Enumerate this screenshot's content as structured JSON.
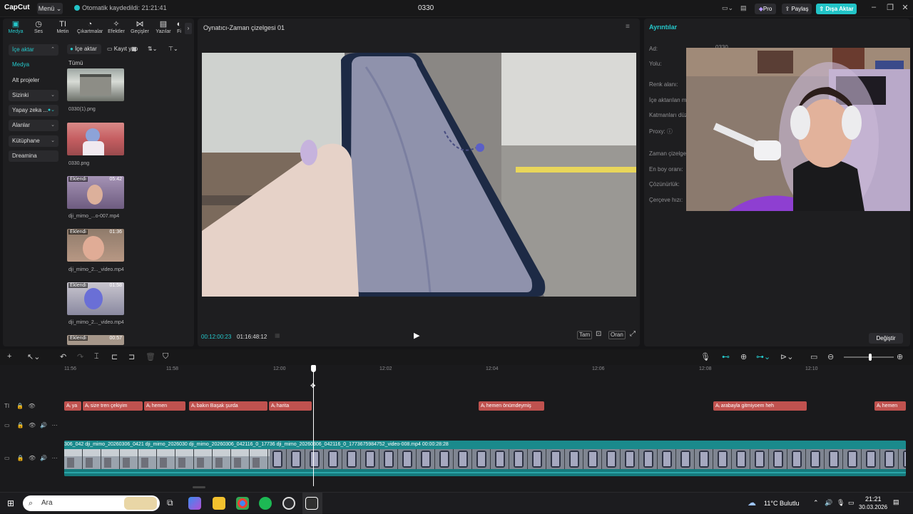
{
  "titlebar": {
    "app_name": "CapCut",
    "menu_label": "Menü",
    "autosave": "Otomatik kaydedildi: 21:21:41",
    "project_title": "0330",
    "pro_label": "Pro",
    "share_label": "Paylaş",
    "export_label": "Dışa Aktar"
  },
  "media_tabs": [
    {
      "label": "Medya",
      "icon": "media-icon"
    },
    {
      "label": "Ses",
      "icon": "audio-icon"
    },
    {
      "label": "Metin",
      "icon": "text-icon"
    },
    {
      "label": "Çıkartmalar",
      "icon": "sticker-icon"
    },
    {
      "label": "Efektler",
      "icon": "effects-icon"
    },
    {
      "label": "Geçişler",
      "icon": "transitions-icon"
    },
    {
      "label": "Yazılar",
      "icon": "captions-icon"
    },
    {
      "label": "Fi",
      "icon": "filters-icon"
    }
  ],
  "sidebar": {
    "items": [
      {
        "label": "İçe aktar"
      },
      {
        "label": "Medya"
      },
      {
        "label": "Alt projeler"
      },
      {
        "label": "Sizinki"
      },
      {
        "label": "Yapay zeka ..."
      },
      {
        "label": "Alanlar"
      },
      {
        "label": "Kütüphane"
      },
      {
        "label": "Dreamina"
      }
    ]
  },
  "media_panel": {
    "import_label": "İçe aktar",
    "record_label": "Kayıt yap",
    "filter_all": "Tümü",
    "items": [
      {
        "name": "0330(1).png",
        "added": "",
        "duration": ""
      },
      {
        "name": "0330.png",
        "added": "",
        "duration": ""
      },
      {
        "name": "dji_mimo_...o-007.mp4",
        "added": "Eklendi",
        "duration": "05:42"
      },
      {
        "name": "dji_mimo_2..._video.mp4",
        "added": "Eklendi",
        "duration": "01:36"
      },
      {
        "name": "dji_mimo_2..._video.mp4",
        "added": "Eklendi",
        "duration": "01:58"
      },
      {
        "name": "",
        "added": "Eklendi",
        "duration": "00:57"
      }
    ]
  },
  "player": {
    "title": "Oynatıcı-Zaman çizelgesi 01",
    "current_time": "00:12:00:23",
    "total_time": "01:16:48:12",
    "full_label": "Tam",
    "ratio_label": "Oran"
  },
  "details": {
    "title": "Ayrıntılar",
    "fields": [
      {
        "label": "Ad:",
        "value": "0330"
      },
      {
        "label": "Yolu:",
        "value": ""
      },
      {
        "label": "Renk alanı:",
        "value": ""
      },
      {
        "label": "İçe aktarılan m...",
        "value": ""
      },
      {
        "label": "Katmanları düz...",
        "value": ""
      },
      {
        "label": "Proxy:",
        "value": ""
      },
      {
        "label": "Zaman çizelgesi...",
        "value": ""
      },
      {
        "label": "En boy oranı:",
        "value": ""
      },
      {
        "label": "Çözünürlük:",
        "value": ""
      },
      {
        "label": "Çerçeve hızı:",
        "value": ""
      }
    ],
    "change_label": "Değiştir"
  },
  "timeline": {
    "ruler": [
      "11:56",
      "11:58",
      "12:00",
      "12:02",
      "12:04",
      "12:06",
      "12:08",
      "12:10"
    ],
    "subtitles": [
      {
        "text": "ya"
      },
      {
        "text": "size tren çekiyim"
      },
      {
        "text": "hemen"
      },
      {
        "text": "bakın Başak şurda"
      },
      {
        "text": "harita"
      },
      {
        "text": "hemen önümdeymiş"
      },
      {
        "text": "arabayla gitmiyoem heh"
      },
      {
        "text": "hemen"
      }
    ],
    "video_clip_label": "306_042  dji_mimo_20260306_0421  dji_mimo_2026030  dji_mimo_20260306_042116_0_17736  dji_mimo_20260306_042116_0_1773675984752_video-008.mp4   00:00:28:28"
  },
  "taskbar": {
    "search_placeholder": "Ara",
    "weather": "11°C  Bulutlu",
    "time": "21:21",
    "date": "30.03.2026"
  },
  "colors": {
    "accent": "#25c9cc",
    "subtitle_clip": "#c0524f",
    "video_clip": "#167a7c"
  }
}
